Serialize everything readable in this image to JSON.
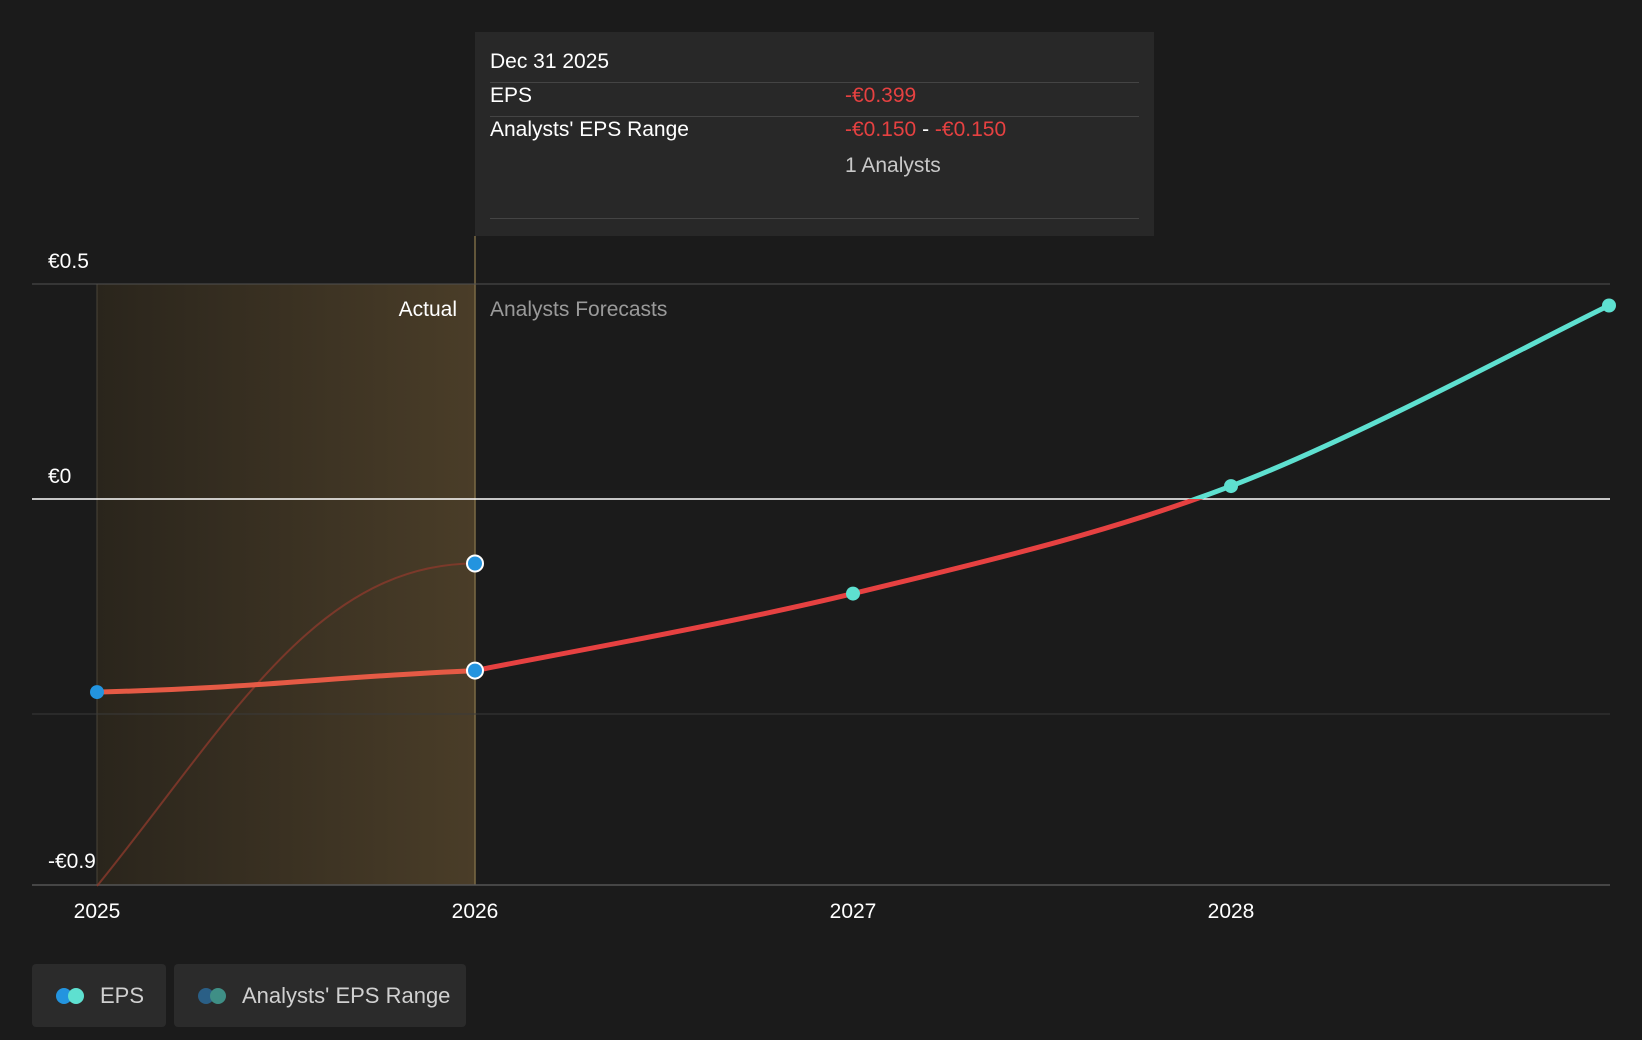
{
  "chart_data": {
    "type": "line",
    "y_ticks": [
      {
        "value": 0.5,
        "label": "€0.5"
      },
      {
        "value": 0,
        "label": "€0"
      },
      {
        "value": -0.9,
        "label": "-€0.9"
      }
    ],
    "ylim": [
      -0.9,
      0.5
    ],
    "x_ticks": [
      {
        "value": 2025,
        "label": "2025"
      },
      {
        "value": 2026,
        "label": "2026"
      },
      {
        "value": 2027,
        "label": "2027"
      },
      {
        "value": 2028,
        "label": "2028"
      }
    ],
    "xlim": [
      2025,
      2029
    ],
    "regions": {
      "actual_label": "Actual",
      "forecast_label": "Analysts Forecasts",
      "actual_range": [
        2025,
        2026
      ]
    },
    "series": [
      {
        "name": "EPS",
        "actual_points": [
          {
            "x": 2025,
            "y": -0.449
          },
          {
            "x": 2026,
            "y": -0.399
          }
        ],
        "forecast_points": [
          {
            "x": 2026,
            "y": -0.399
          },
          {
            "x": 2027,
            "y": -0.22
          },
          {
            "x": 2028,
            "y": 0.03
          },
          {
            "x": 2029,
            "y": 0.45
          }
        ],
        "colors": {
          "negative": "#e64141",
          "positive": "#5ee0d0",
          "actual_marker": "#2394df"
        }
      },
      {
        "name": "Analysts' EPS Range",
        "points": [
          {
            "x": 2025,
            "y": -0.9
          },
          {
            "x": 2026,
            "y": -0.15
          }
        ],
        "color": "#8a3a2c"
      }
    ],
    "tooltip": {
      "date": "Dec 31 2025",
      "eps_label": "EPS",
      "eps_value": "-€0.399",
      "range_label": "Analysts' EPS Range",
      "range_low": "-€0.150",
      "range_separator": "-",
      "range_high": "-€0.150",
      "analysts": "1 Analysts"
    }
  },
  "legend": [
    {
      "label": "EPS",
      "colors": [
        "#2394df",
        "#5ee0d0"
      ]
    },
    {
      "label": "Analysts' EPS Range",
      "colors": [
        "#2a5f86",
        "#3f8f86"
      ]
    }
  ],
  "colors": {
    "background": "#1b1b1b",
    "actual_band_start": "#2a251c",
    "actual_band_end": "#4a3d28",
    "zero_line": "#ffffff",
    "grid": "#3a3a3a"
  }
}
